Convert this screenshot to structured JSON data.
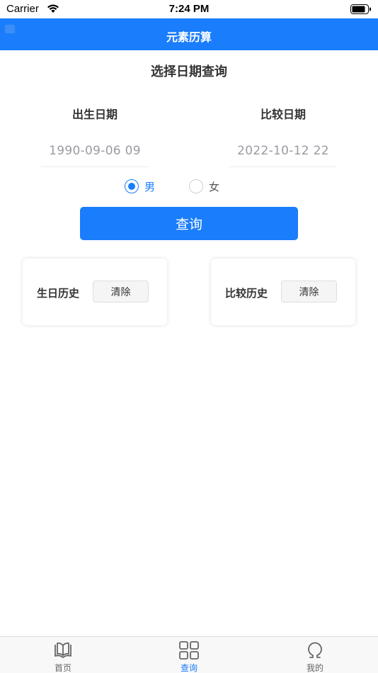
{
  "status_bar": {
    "carrier": "Carrier",
    "time": "7:24 PM"
  },
  "nav": {
    "title": "元素历算"
  },
  "page": {
    "title": "选择日期查询"
  },
  "birth": {
    "label": "出生日期",
    "value": "1990-09-06 09"
  },
  "compare": {
    "label": "比较日期",
    "value": "2022-10-12 22"
  },
  "gender": {
    "options": [
      {
        "label": "男",
        "selected": true
      },
      {
        "label": "女",
        "selected": false
      }
    ]
  },
  "query_button": {
    "label": "查询"
  },
  "history": [
    {
      "label": "生日历史",
      "clear_label": "清除"
    },
    {
      "label": "比较历史",
      "clear_label": "清除"
    }
  ],
  "tabs": [
    {
      "label": "首页",
      "icon": "book-icon",
      "active": false
    },
    {
      "label": "查询",
      "icon": "grid-icon",
      "active": true
    },
    {
      "label": "我的",
      "icon": "omega-icon",
      "active": false
    }
  ],
  "colors": {
    "accent": "#1a7dfc",
    "inactive": "#666666"
  }
}
